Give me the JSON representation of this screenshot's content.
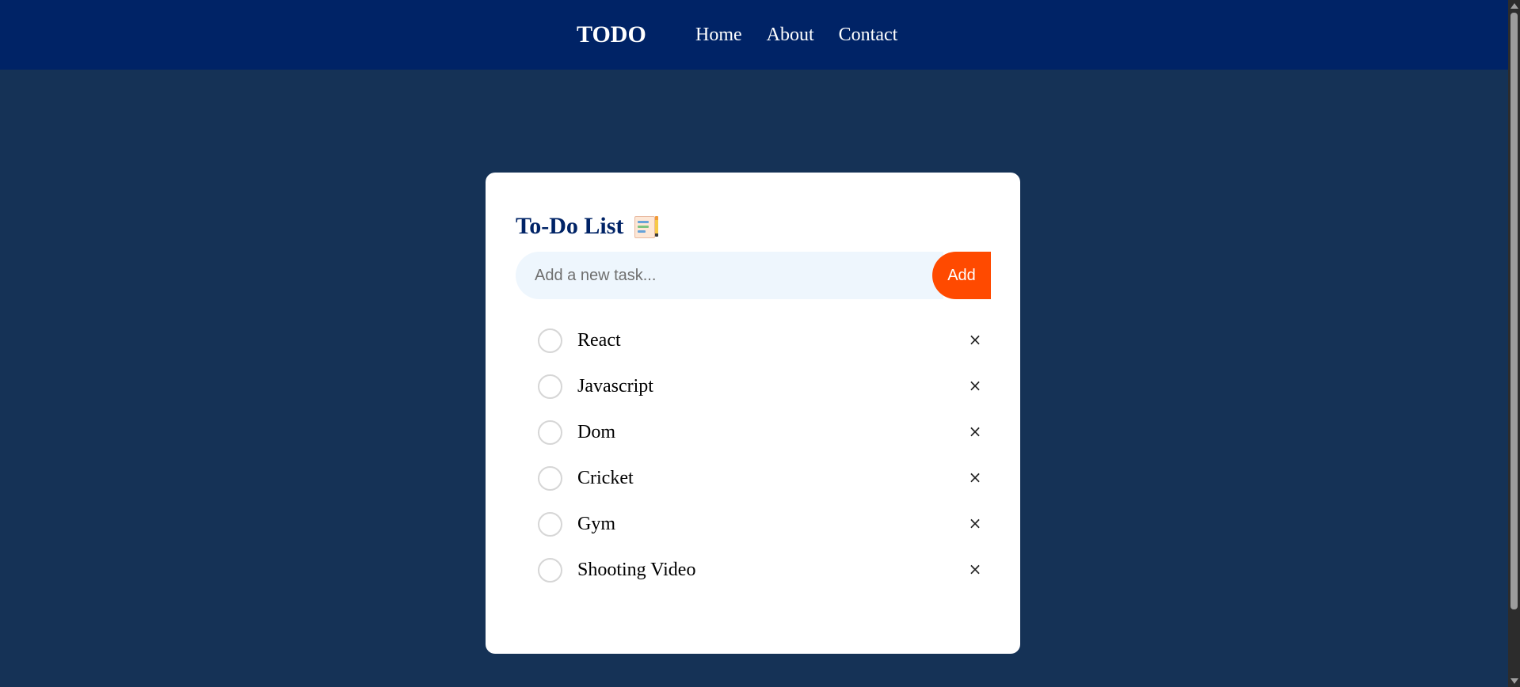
{
  "nav": {
    "brand": "TODO",
    "links": [
      "Home",
      "About",
      "Contact"
    ]
  },
  "card": {
    "title": "To-Do List",
    "title_icon": "checklist-notepad-icon",
    "input": {
      "placeholder": "Add a new task...",
      "value": ""
    },
    "add_label": "Add",
    "tasks": [
      {
        "text": "React",
        "done": false
      },
      {
        "text": "Javascript",
        "done": false
      },
      {
        "text": "Dom",
        "done": false
      },
      {
        "text": "Cricket",
        "done": false
      },
      {
        "text": "Gym",
        "done": false
      },
      {
        "text": "Shooting Video",
        "done": false
      }
    ],
    "delete_glyph": "×"
  },
  "colors": {
    "navbar": "#002366",
    "page_background": "#153256",
    "accent": "#ff4a00",
    "title": "#002366",
    "input_background": "#eef6fd"
  }
}
